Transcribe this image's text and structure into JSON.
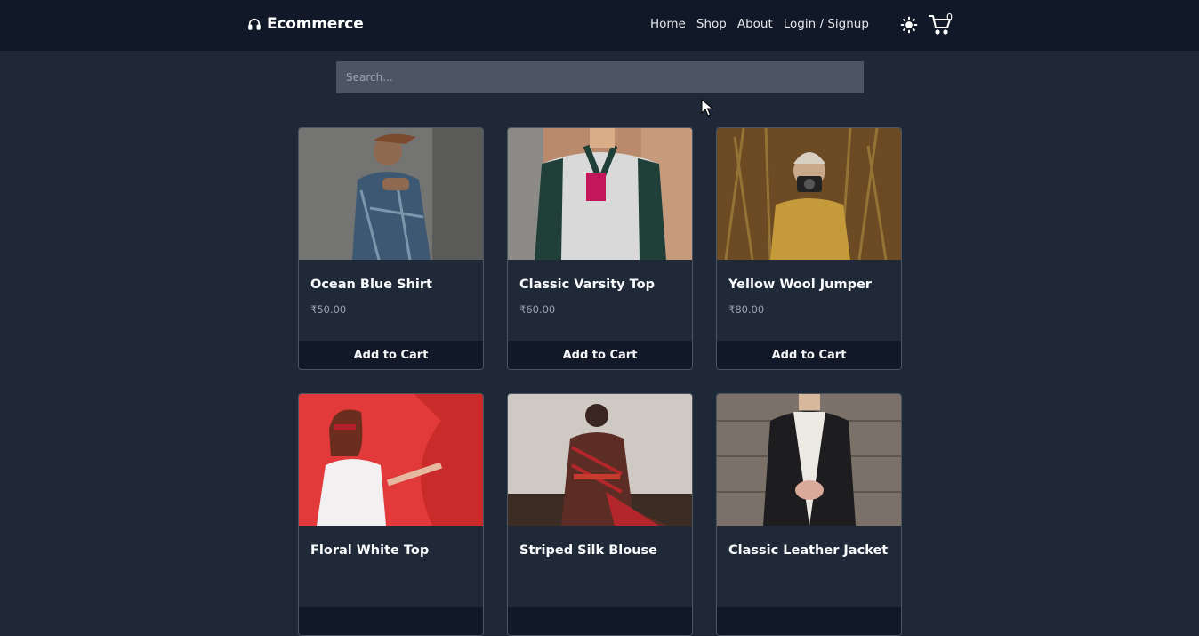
{
  "navbar": {
    "brand": "Ecommerce",
    "links": [
      "Home",
      "Shop",
      "About",
      "Login / Signup"
    ],
    "cart_count": "0"
  },
  "search": {
    "placeholder": "Search...",
    "value": ""
  },
  "products": [
    {
      "name": "Ocean Blue Shirt",
      "price": "₹50.00",
      "button": "Add to Cart"
    },
    {
      "name": "Classic Varsity Top",
      "price": "₹60.00",
      "button": "Add to Cart"
    },
    {
      "name": "Yellow Wool Jumper",
      "price": "₹80.00",
      "button": "Add to Cart"
    },
    {
      "name": "Floral White Top",
      "price": "",
      "button": ""
    },
    {
      "name": "Striped Silk Blouse",
      "price": "",
      "button": ""
    },
    {
      "name": "Classic Leather Jacket",
      "price": "",
      "button": ""
    }
  ],
  "icons": {
    "brand": "headphones-icon",
    "theme": "sun-icon",
    "cart": "cart-icon"
  },
  "colors": {
    "page_bg": "#1f2837",
    "navbar_bg": "#111827",
    "card_bg": "#1f2937",
    "button_bg": "#111827",
    "search_bg": "#4b5563"
  }
}
